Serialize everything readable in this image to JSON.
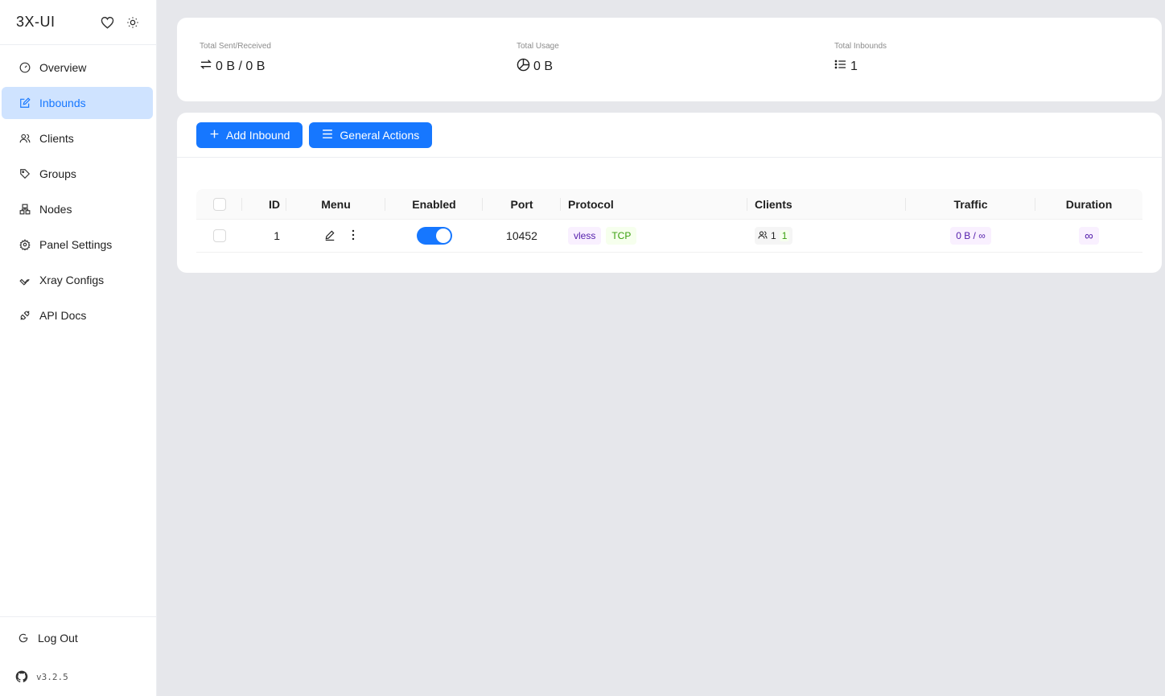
{
  "brand": {
    "title": "3X-UI"
  },
  "sidebar": {
    "items": [
      {
        "label": "Overview",
        "icon": "dashboard-icon",
        "active": false
      },
      {
        "label": "Inbounds",
        "icon": "edit-square-icon",
        "active": true
      },
      {
        "label": "Clients",
        "icon": "users-icon",
        "active": false
      },
      {
        "label": "Groups",
        "icon": "tag-icon",
        "active": false
      },
      {
        "label": "Nodes",
        "icon": "cluster-icon",
        "active": false
      },
      {
        "label": "Panel Settings",
        "icon": "gear-icon",
        "active": false
      },
      {
        "label": "Xray Configs",
        "icon": "wrench-icon",
        "active": false
      },
      {
        "label": "API Docs",
        "icon": "api-icon",
        "active": false
      }
    ],
    "logout_label": "Log Out",
    "version": "v3.2.5"
  },
  "stats": {
    "sent_received": {
      "label": "Total Sent/Received",
      "value": "0 B / 0 B"
    },
    "usage": {
      "label": "Total Usage",
      "value": "0 B"
    },
    "inbounds": {
      "label": "Total Inbounds",
      "value": "1"
    }
  },
  "toolbar": {
    "add_label": "Add Inbound",
    "general_label": "General Actions"
  },
  "table": {
    "headers": {
      "id": "ID",
      "menu": "Menu",
      "enabled": "Enabled",
      "port": "Port",
      "protocol": "Protocol",
      "clients": "Clients",
      "traffic": "Traffic",
      "duration": "Duration"
    },
    "rows": [
      {
        "id": "1",
        "enabled": true,
        "port": "10452",
        "protocol": "vless",
        "transport": "TCP",
        "clients_total": "1",
        "clients_active": "1",
        "traffic": "0 B / ∞",
        "duration": "∞"
      }
    ]
  },
  "colors": {
    "primary": "#1677ff",
    "active_bg": "#cfe3ff",
    "page_bg": "#e6e7eb"
  }
}
